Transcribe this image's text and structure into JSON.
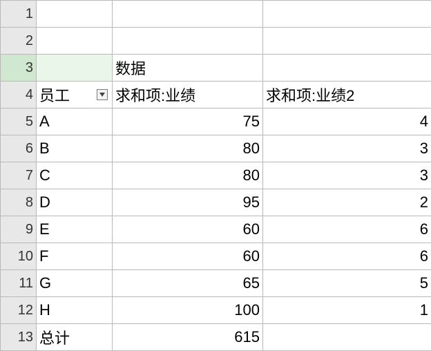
{
  "row_numbers": [
    "1",
    "2",
    "3",
    "4",
    "5",
    "6",
    "7",
    "8",
    "9",
    "10",
    "11",
    "12",
    "13"
  ],
  "header_group_label": "数据",
  "col_headers": {
    "a": "员工",
    "b": "求和项:业绩",
    "c": "求和项:业绩2"
  },
  "rows": [
    {
      "employee": "A",
      "sum1": "75",
      "sum2": "4"
    },
    {
      "employee": "B",
      "sum1": "80",
      "sum2": "3"
    },
    {
      "employee": "C",
      "sum1": "80",
      "sum2": "3"
    },
    {
      "employee": "D",
      "sum1": "95",
      "sum2": "2"
    },
    {
      "employee": "E",
      "sum1": "60",
      "sum2": "6"
    },
    {
      "employee": "F",
      "sum1": "60",
      "sum2": "6"
    },
    {
      "employee": "G",
      "sum1": "65",
      "sum2": "5"
    },
    {
      "employee": "H",
      "sum1": "100",
      "sum2": "1"
    }
  ],
  "total": {
    "label": "总计",
    "sum1": "615",
    "sum2": ""
  },
  "chart_data": {
    "type": "table",
    "title": "数据",
    "columns": [
      "员工",
      "求和项:业绩",
      "求和项:业绩2"
    ],
    "data": [
      [
        "A",
        75,
        4
      ],
      [
        "B",
        80,
        3
      ],
      [
        "C",
        80,
        3
      ],
      [
        "D",
        95,
        2
      ],
      [
        "E",
        60,
        6
      ],
      [
        "F",
        60,
        6
      ],
      [
        "G",
        65,
        5
      ],
      [
        "H",
        100,
        1
      ]
    ],
    "totals": {
      "员工": "总计",
      "求和项:业绩": 615,
      "求和项:业绩2": null
    }
  }
}
